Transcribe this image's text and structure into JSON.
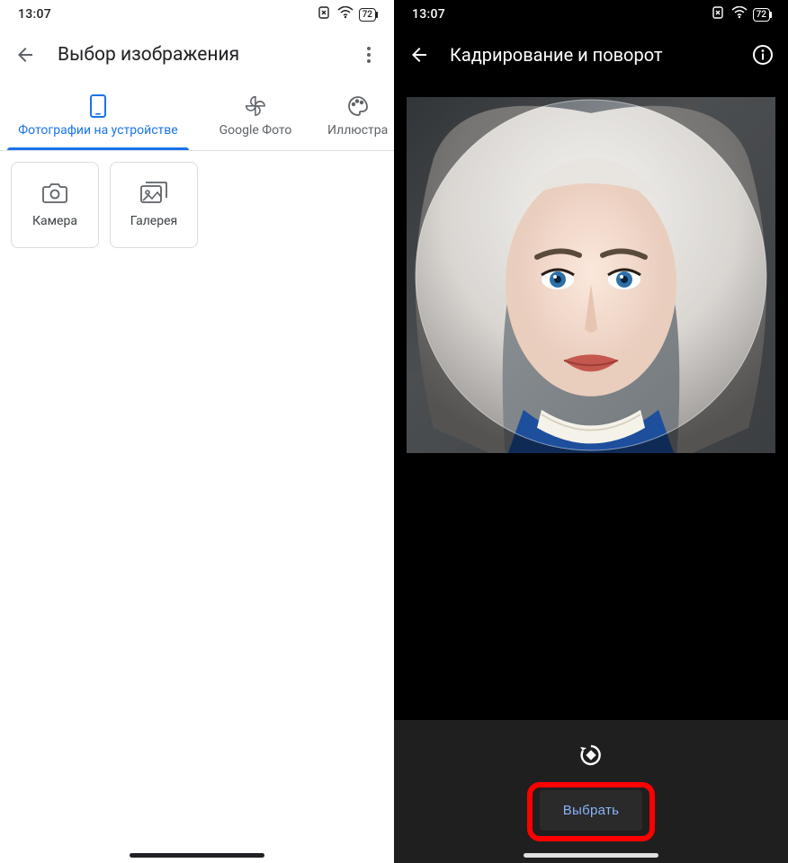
{
  "status": {
    "time": "13:07",
    "battery": "72"
  },
  "left": {
    "title": "Выбор изображения",
    "tabs": [
      {
        "label": "Фотографии на устройстве",
        "active": true
      },
      {
        "label": "Google Фото",
        "active": false
      },
      {
        "label": "Иллюстра",
        "active": false
      }
    ],
    "cards": {
      "camera": "Камера",
      "gallery": "Галерея"
    }
  },
  "right": {
    "title": "Кадрирование и поворот",
    "select_label": "Выбрать"
  }
}
